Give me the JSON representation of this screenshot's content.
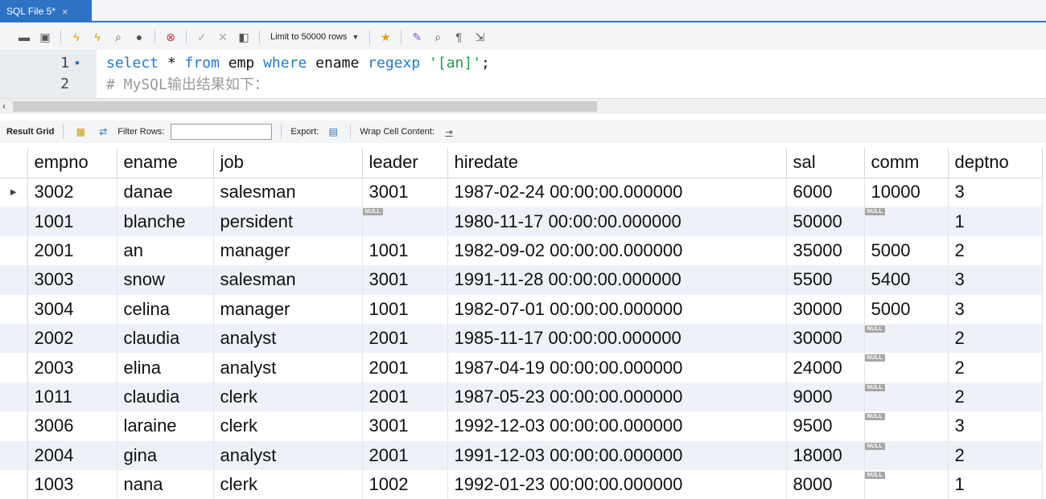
{
  "tab": {
    "title": "SQL File 5*",
    "close": "×"
  },
  "toolbar": {
    "limit_label": "Limit to 50000 rows"
  },
  "editor": {
    "lines": [
      {
        "num": "1",
        "marker": "•"
      },
      {
        "num": "2",
        "marker": ""
      }
    ],
    "line1": {
      "select": "select",
      "star": " * ",
      "from": "from",
      "table": " emp ",
      "where": "where",
      "col": " ename ",
      "regexp": "regexp",
      "sp": " ",
      "pattern": "'[an]'",
      "semi": ";"
    },
    "line2_comment": "# MySQL输出结果如下："
  },
  "result_toolbar": {
    "result_grid": "Result Grid",
    "filter_rows": "Filter Rows:",
    "export": "Export:",
    "wrap": "Wrap Cell Content:"
  },
  "null_label": "NULL",
  "table": {
    "columns": [
      "empno",
      "ename",
      "job",
      "leader",
      "hiredate",
      "sal",
      "comm",
      "deptno"
    ],
    "rows": [
      [
        "3002",
        "danae",
        "salesman",
        "3001",
        "1987-02-24 00:00:00.000000",
        "6000",
        "10000",
        "3"
      ],
      [
        "1001",
        "blanche",
        "persident",
        null,
        "1980-11-17 00:00:00.000000",
        "50000",
        null,
        "1"
      ],
      [
        "2001",
        "an",
        "manager",
        "1001",
        "1982-09-02 00:00:00.000000",
        "35000",
        "5000",
        "2"
      ],
      [
        "3003",
        "snow",
        "salesman",
        "3001",
        "1991-11-28 00:00:00.000000",
        "5500",
        "5400",
        "3"
      ],
      [
        "3004",
        "celina",
        "manager",
        "1001",
        "1982-07-01 00:00:00.000000",
        "30000",
        "5000",
        "3"
      ],
      [
        "2002",
        "claudia",
        "analyst",
        "2001",
        "1985-11-17 00:00:00.000000",
        "30000",
        null,
        "2"
      ],
      [
        "2003",
        "elina",
        "analyst",
        "2001",
        "1987-04-19 00:00:00.000000",
        "24000",
        null,
        "2"
      ],
      [
        "1011",
        "claudia",
        "clerk",
        "2001",
        "1987-05-23 00:00:00.000000",
        "9000",
        null,
        "2"
      ],
      [
        "3006",
        "laraine",
        "clerk",
        "3001",
        "1992-12-03 00:00:00.000000",
        "9500",
        null,
        "3"
      ],
      [
        "2004",
        "gina",
        "analyst",
        "2001",
        "1991-12-03 00:00:00.000000",
        "18000",
        null,
        "2"
      ],
      [
        "1003",
        "nana",
        "clerk",
        "1002",
        "1992-01-23 00:00:00.000000",
        "8000",
        null,
        "1"
      ]
    ]
  }
}
